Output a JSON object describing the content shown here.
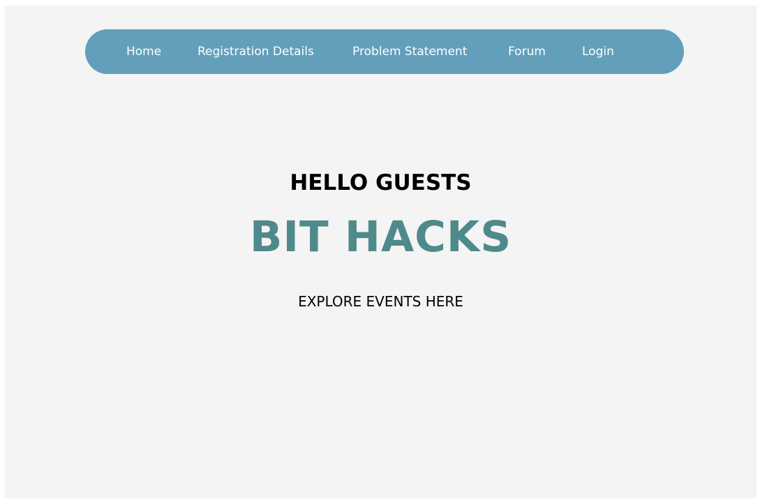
{
  "nav": {
    "items": [
      {
        "label": "Home"
      },
      {
        "label": "Registration Details"
      },
      {
        "label": "Problem Statement"
      },
      {
        "label": "Forum"
      },
      {
        "label": "Login"
      }
    ]
  },
  "hero": {
    "greeting": "HELLO GUESTS",
    "title": "BIT HACKS",
    "cta": "EXPLORE EVENTS HERE"
  },
  "colors": {
    "background": "#f4f4f4",
    "navbar": "#639fbb",
    "nav_text": "#ffffff",
    "accent_title": "#4f8a8b",
    "text": "#000000"
  }
}
